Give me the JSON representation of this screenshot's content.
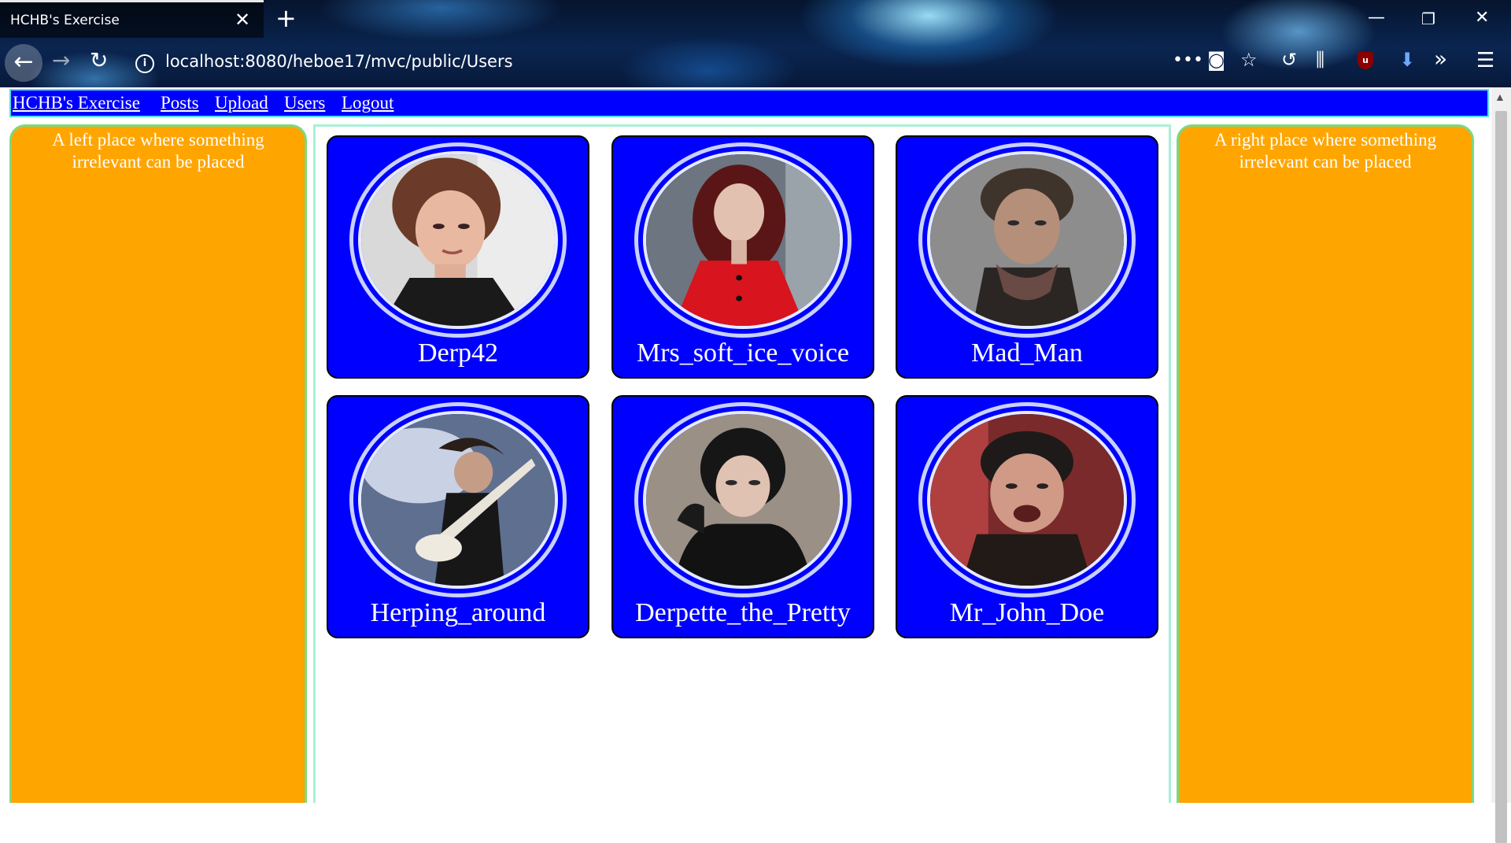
{
  "browser": {
    "tab_title": "HCHB's Exercise",
    "url": "localhost:8080/heboe17/mvc/public/Users",
    "icons": [
      "close-icon",
      "new-tab-icon",
      "minimize-icon",
      "restore-icon",
      "window-close-icon",
      "back-icon",
      "forward-icon",
      "reload-icon",
      "info-icon",
      "more-icon",
      "pocket-icon",
      "bookmark-star-icon",
      "history-icon",
      "library-icon",
      "ublock-icon",
      "download-icon",
      "overflow-icon",
      "menu-icon"
    ]
  },
  "nav": {
    "links": [
      "HCHB's Exercise",
      "Posts",
      "Upload",
      "Users",
      "Logout"
    ]
  },
  "left_panel": {
    "text": "A left place where something irrelevant can be placed"
  },
  "right_panel": {
    "text": "A right place where something irrelevant can be placed"
  },
  "users": [
    {
      "name": "Derp42"
    },
    {
      "name": "Mrs_soft_ice_voice"
    },
    {
      "name": "Mad_Man"
    },
    {
      "name": "Herping_around"
    },
    {
      "name": "Derpette_the_Pretty"
    },
    {
      "name": "Mr_John_Doe"
    }
  ],
  "colors": {
    "nav_bg": "#0000ff",
    "side_bg": "#ffa500",
    "card_bg": "#0000ff"
  }
}
